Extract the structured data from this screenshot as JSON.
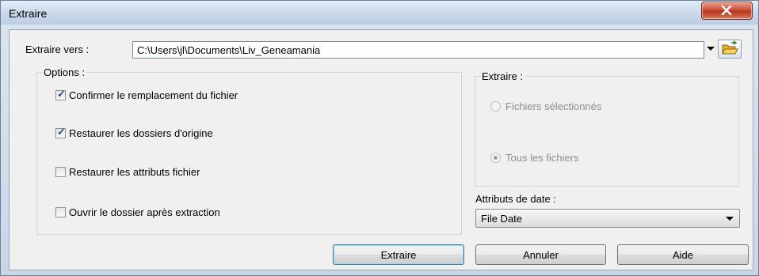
{
  "window": {
    "title": "Extraire"
  },
  "destination": {
    "label": "Extraire vers :",
    "path": "C:\\Users\\jl\\Documents\\Liv_Geneamania"
  },
  "options": {
    "title": "Options :",
    "items": [
      {
        "label": "Confirmer le remplacement du fichier",
        "checked": true
      },
      {
        "label": "Restaurer les dossiers d'origine",
        "checked": true
      },
      {
        "label": "Restaurer les attributs fichier",
        "checked": false
      },
      {
        "label": "Ouvrir le dossier après extraction",
        "checked": false
      }
    ]
  },
  "extract_group": {
    "title": "Extraire :",
    "radios": [
      {
        "label": "Fichiers sélectionnés",
        "selected": false,
        "disabled": true
      },
      {
        "label": "Tous les fichiers",
        "selected": true,
        "disabled": true
      }
    ]
  },
  "date_attributes": {
    "label": "Attributs de date :",
    "value": "File Date"
  },
  "buttons": {
    "extract": "Extraire",
    "cancel": "Annuler",
    "help": "Aide"
  },
  "colors": {
    "close_button": "#c8462c",
    "default_button_border": "#3c7fb1"
  },
  "icons": {
    "close": "close-icon",
    "folder": "folder-open-icon",
    "dropdown": "chevron-down-icon"
  }
}
